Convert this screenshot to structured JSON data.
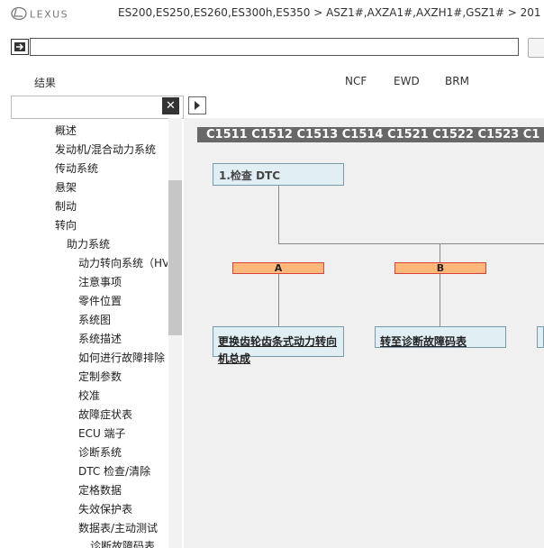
{
  "header": {
    "brand": "LEXUS",
    "breadcrumb": "ES200,ES250,ES260,ES300h,ES350 > ASZ1#,AXZA1#,AXZH1#,GSZ1# > 201"
  },
  "tabs": {
    "results": "结果",
    "ncf": "NCF",
    "ewd": "EWD",
    "brm": "BRM"
  },
  "panel": {
    "close_label": "✕"
  },
  "tree": [
    "概述",
    "发动机/混合动力系统",
    "传动系统",
    "悬架",
    "制动",
    "转向",
    "助力系统",
    "动力转向系统（HV",
    "注意事项",
    "零件位置",
    "系统图",
    "系统描述",
    "如何进行故障排除",
    "定制参数",
    "校准",
    "故障症状表",
    "ECU 端子",
    "诊断系统",
    "DTC 检查/清除",
    "定格数据",
    "失效保护表",
    "数据表/主动测试",
    "诊断故障码表"
  ],
  "content": {
    "codes": "C1511  C1512  C1513  C1514  C1521  C1522  C1523  C1",
    "step_title": "1.检查 DTC",
    "branch_a": "A",
    "branch_b": "B",
    "result_a": "更换齿轮齿条式动力转向机总成",
    "result_b": "转至诊断故障码表"
  },
  "colors": {
    "code_strip_bg": "#686868",
    "box_bg": "#e1eef4",
    "label_bg": "#ffb77a",
    "label_border": "#d8433a"
  }
}
